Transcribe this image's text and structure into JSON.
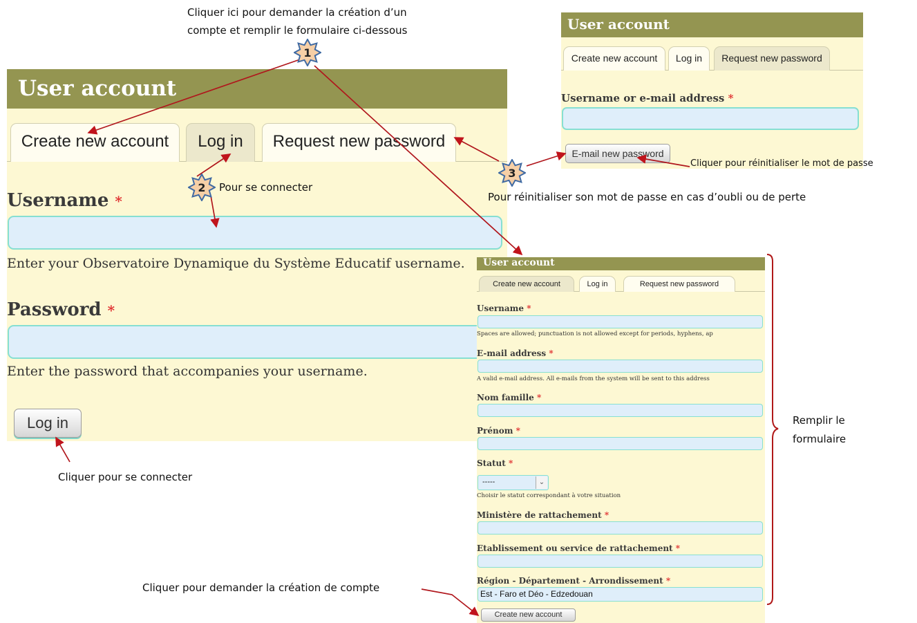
{
  "colors": {
    "header": "#949551",
    "panel": "#fdf8d3",
    "input": "#dfeefa",
    "input_border": "#86dfd2",
    "required": "#e03030",
    "arrow": "#c0141c",
    "star_fill": "#f6cfa6",
    "star_stroke": "#3f6aa3"
  },
  "main_form": {
    "title": "User account",
    "tabs": {
      "create": "Create new account",
      "login": "Log in",
      "request": "Request new password"
    },
    "username": {
      "label": "Username",
      "required": "*",
      "description": "Enter your Observatoire Dynamique du Système Educatif username."
    },
    "password": {
      "label": "Password",
      "required": "*",
      "description": "Enter the password that accompanies your username."
    },
    "submit": "Log in"
  },
  "reset_form": {
    "title": "User account",
    "tabs": {
      "create": "Create new account",
      "login": "Log in",
      "request": "Request new password"
    },
    "field": {
      "label": "Username or e-mail address",
      "required": "*"
    },
    "submit": "E-mail new password"
  },
  "register_form": {
    "title": "User account",
    "tabs": {
      "create": "Create new account",
      "login": "Log in",
      "request": "Request new password"
    },
    "username": {
      "label": "Username",
      "required": "*",
      "description": "Spaces are allowed; punctuation is not allowed except for periods, hyphens, ap"
    },
    "email": {
      "label": "E-mail address",
      "required": "*",
      "description": "A valid e-mail address. All e-mails from the system will be sent to this address"
    },
    "nom": {
      "label": "Nom famille",
      "required": "*"
    },
    "prenom": {
      "label": "Prénom",
      "required": "*"
    },
    "statut": {
      "label": "Statut",
      "required": "*",
      "selected": "-----",
      "description": "Choisir le statut correspondant à votre situation"
    },
    "ministere": {
      "label": "Ministère de rattachement",
      "required": "*"
    },
    "etablissement": {
      "label": "Etablissement ou service de rattachement",
      "required": "*"
    },
    "region": {
      "label": "Région - Département - Arrondissement",
      "required": "*",
      "value": "Est - Faro et Déo - Edzedouan"
    },
    "submit": "Create new account"
  },
  "annotations": {
    "step1_line1": "Cliquer ici pour demander la création d’un",
    "step1_line2": "compte et remplir le formulaire ci-dessous",
    "step2": "Pour se connecter",
    "step3_reset_click": "Cliquer pour réinitialiser le mot de passe",
    "step3": "Pour réinitialiser son mot de passe en cas d’oubli ou de perte",
    "login_click": "Cliquer pour se connecter",
    "fill_line1": "Remplir le",
    "fill_line2": "formulaire",
    "create_click": "Cliquer pour demander la création de compte"
  },
  "steps": {
    "one": "1",
    "two": "2",
    "three": "3"
  }
}
